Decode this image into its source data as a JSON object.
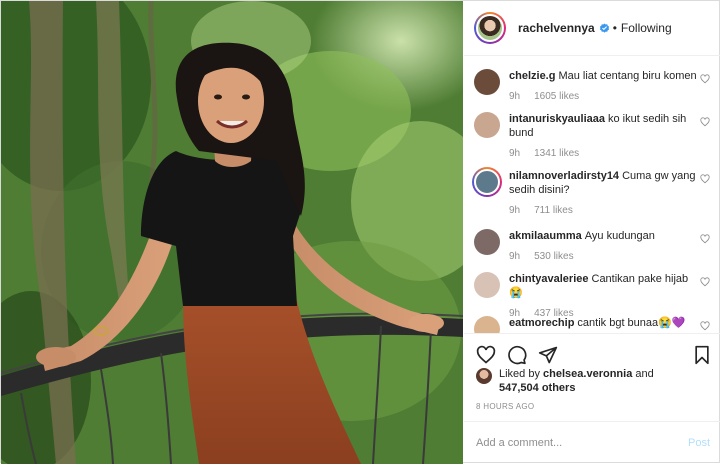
{
  "post": {
    "photo_alt": "photo",
    "author": {
      "username": "rachelvennya",
      "verified": true,
      "follow_status": "Following"
    },
    "comments": [
      {
        "username": "chelzie.g",
        "text": "Mau liat centang biru komen",
        "age": "9h",
        "likes": "1605 likes",
        "avatar_color": "#6b4c3b",
        "story_ring": false
      },
      {
        "username": "intanuriskyauliaaa",
        "text": "ko ikut sedih sih bund",
        "age": "9h",
        "likes": "1341 likes",
        "avatar_color": "#c9a690",
        "story_ring": false
      },
      {
        "username": "nilamnoverladirsty14",
        "text": "Cuma gw yang sedih disini?",
        "age": "9h",
        "likes": "711 likes",
        "avatar_color": "#5d7a8c",
        "story_ring": true
      },
      {
        "username": "akmilaaumma",
        "text": "Ayu kudungan",
        "age": "9h",
        "likes": "530 likes",
        "avatar_color": "#7d6a66",
        "story_ring": false
      },
      {
        "username": "chintyavaleriee",
        "text": "Cantikan pake hijab 😭",
        "age": "9h",
        "likes": "437 likes",
        "avatar_color": "#d8c2b6",
        "story_ring": false
      },
      {
        "username": "eatmorechip",
        "text": "cantik bgt bunaa😭💜",
        "age": "",
        "likes": "",
        "avatar_color": "#d9b48f",
        "story_ring": false
      }
    ],
    "liked_by": {
      "prefix": "Liked by",
      "user": "chelsea.veronnia",
      "conj": "and",
      "count": "547,504 others"
    },
    "timestamp": "8 HOURS AGO",
    "add_comment": {
      "placeholder": "Add a comment...",
      "post_label": "Post"
    },
    "icons": {
      "like": "heart-icon",
      "comment": "comment-icon",
      "share": "share-icon",
      "save": "bookmark-icon",
      "verified": "verified-badge-icon"
    },
    "colors": {
      "verified_blue": "#3897f0",
      "post_button_disabled": "#b2dffc",
      "meta_gray": "#8e8e8e"
    }
  }
}
